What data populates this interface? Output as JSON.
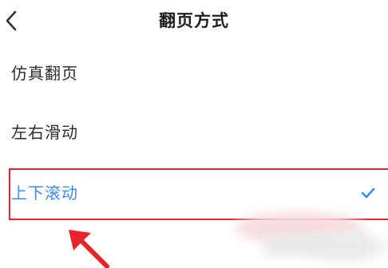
{
  "header": {
    "back_icon": "chevron-left-icon",
    "title": "翻页方式"
  },
  "options": [
    {
      "label": "仿真翻页",
      "selected": false
    },
    {
      "label": "左右滑动",
      "selected": false
    },
    {
      "label": "上下滚动",
      "selected": true
    }
  ],
  "colors": {
    "accent": "#3b8cf0",
    "highlight": "#e8232a",
    "text": "#2b2b2b"
  },
  "annotation": {
    "check_icon": "checkmark-icon",
    "arrow_icon": "red-arrow-icon"
  }
}
